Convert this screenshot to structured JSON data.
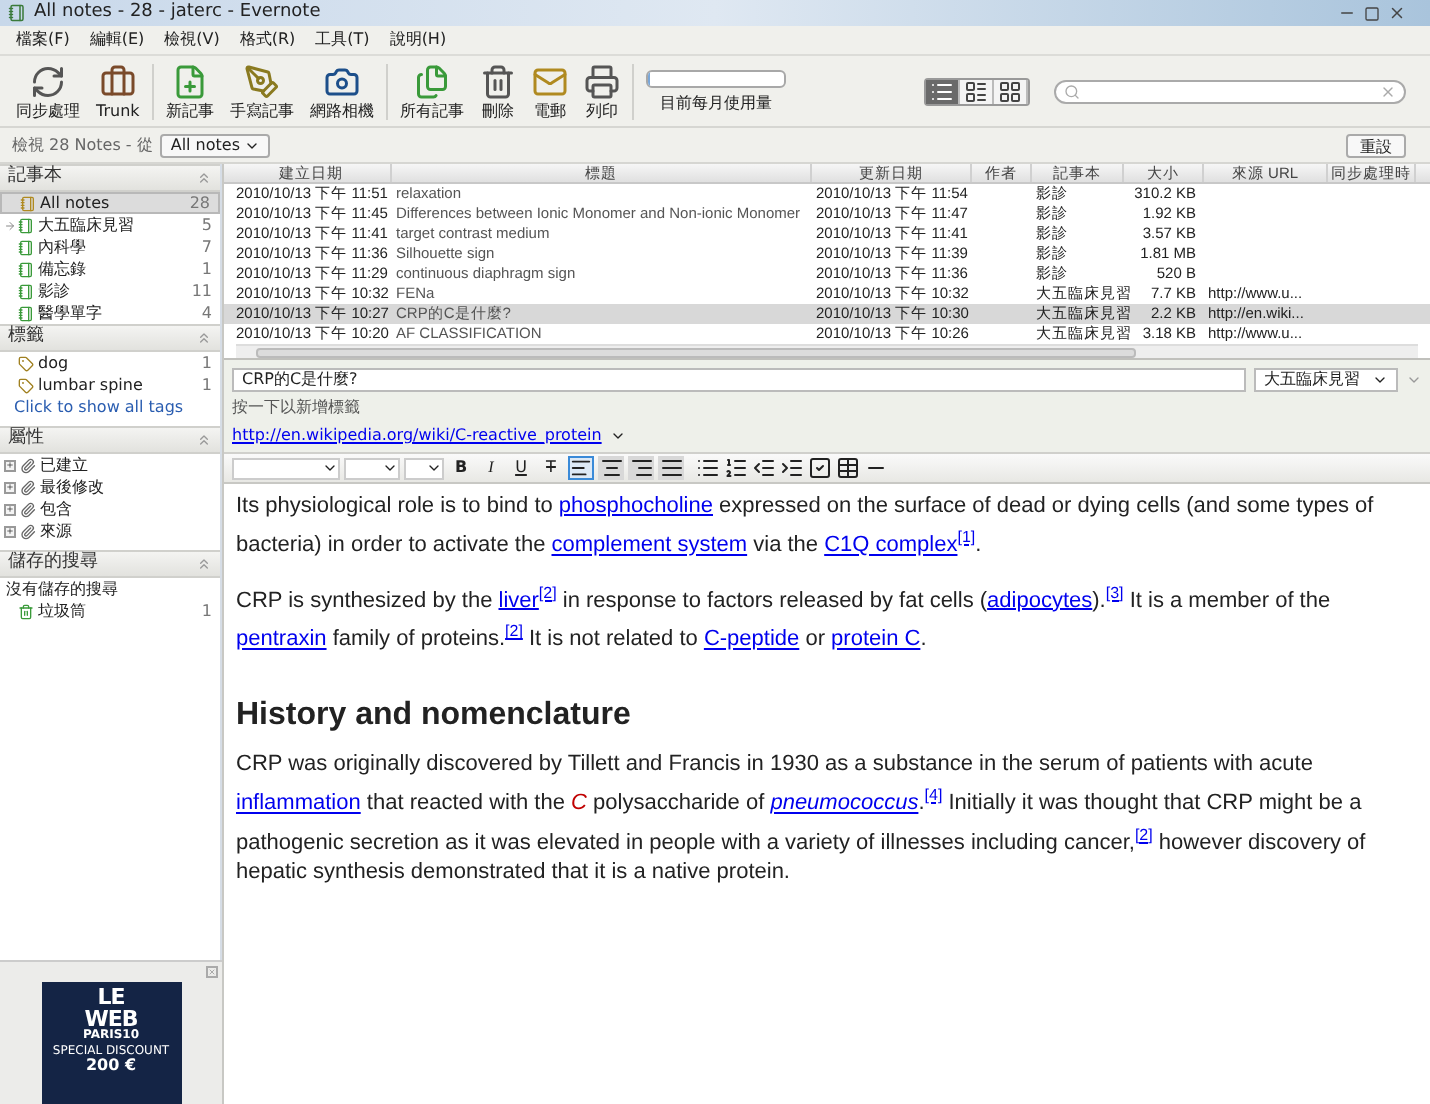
{
  "window": {
    "title": "All notes - 28 - jaterc - Evernote"
  },
  "menu": [
    "檔案(F)",
    "編輯(E)",
    "檢視(V)",
    "格式(R)",
    "工具(T)",
    "說明(H)"
  ],
  "toolbar": [
    {
      "kind": "sync",
      "label": "同步處理"
    },
    {
      "kind": "trunk",
      "label": "Trunk"
    },
    {
      "kind": "new",
      "label": "新記事"
    },
    {
      "kind": "ink",
      "label": "手寫記事"
    },
    {
      "kind": "webcam",
      "label": "網路相機"
    },
    {
      "kind": "all",
      "label": "所有記事"
    },
    {
      "kind": "delete",
      "label": "刪除"
    },
    {
      "kind": "email",
      "label": "電郵"
    },
    {
      "kind": "print",
      "label": "列印"
    }
  ],
  "usage": {
    "label": "目前每月使用量",
    "level": 0.02
  },
  "view_modes": [
    {
      "kind": "list",
      "selected": true
    },
    {
      "kind": "summary",
      "selected": false
    },
    {
      "kind": "thumbs",
      "selected": false
    }
  ],
  "filter": {
    "label": "檢視 28 Notes - 從",
    "dropdown": "All notes",
    "reset": "重設"
  },
  "sidebar": {
    "notebooks": {
      "title": "記事本",
      "items": [
        {
          "name": "All notes",
          "count": "28",
          "selected": true,
          "default": false
        },
        {
          "name": "大五臨床見習",
          "count": "5",
          "selected": false,
          "default": true
        },
        {
          "name": "內科學",
          "count": "7",
          "selected": false,
          "default": false
        },
        {
          "name": "備忘錄",
          "count": "1",
          "selected": false,
          "default": false
        },
        {
          "name": "影診",
          "count": "11",
          "selected": false,
          "default": false
        },
        {
          "name": "醫學單字",
          "count": "4",
          "selected": false,
          "default": false
        }
      ]
    },
    "tags": {
      "title": "標籤",
      "items": [
        {
          "name": "dog",
          "count": "1"
        },
        {
          "name": "lumbar spine",
          "count": "1"
        }
      ],
      "link": "Click to show all tags"
    },
    "attributes": {
      "title": "屬性",
      "items": [
        {
          "name": "已建立",
          "expanded": false
        },
        {
          "name": "最後修改",
          "expanded": false
        },
        {
          "name": "包含",
          "expanded": false
        },
        {
          "name": "來源",
          "expanded": false
        }
      ]
    },
    "saved_searches": {
      "title": "儲存的搜尋",
      "empty": "沒有儲存的搜尋",
      "trash": {
        "name": "垃圾筒",
        "count": "1"
      }
    },
    "ad": {
      "lines": [
        "LE",
        "WEB",
        "PARIS10",
        "SPECIAL DISCOUNT",
        "200 €"
      ]
    }
  },
  "table": {
    "columns": [
      "建立日期",
      "標題",
      "更新日期",
      "作者",
      "記事本",
      "大小",
      "來源 URL",
      "同步處理時"
    ],
    "rows": [
      {
        "cells": [
          "2010/10/13 下午 11:51",
          "relaxation",
          "2010/10/13 下午 11:54",
          "",
          "影診",
          "310.2 KB",
          ""
        ],
        "selected": false
      },
      {
        "cells": [
          "2010/10/13 下午 11:45",
          "Differences between Ionic Monomer and Non-ionic Monomer",
          "2010/10/13 下午 11:47",
          "",
          "影診",
          "1.92 KB",
          ""
        ],
        "selected": false
      },
      {
        "cells": [
          "2010/10/13 下午 11:41",
          "target contrast medium",
          "2010/10/13 下午 11:41",
          "",
          "影診",
          "3.57 KB",
          ""
        ],
        "selected": false
      },
      {
        "cells": [
          "2010/10/13 下午 11:36",
          "Silhouette sign",
          "2010/10/13 下午 11:39",
          "",
          "影診",
          "1.81 MB",
          ""
        ],
        "selected": false
      },
      {
        "cells": [
          "2010/10/13 下午 11:29",
          "continuous diaphragm sign",
          "2010/10/13 下午 11:36",
          "",
          "影診",
          "520 B",
          ""
        ],
        "selected": false
      },
      {
        "cells": [
          "2010/10/13 下午 10:32",
          "FENa",
          "2010/10/13 下午 10:32",
          "",
          "大五臨床見習",
          "7.7 KB",
          "http://www.u..."
        ],
        "selected": false
      },
      {
        "cells": [
          "2010/10/13 下午 10:27",
          "CRP的C是什麼?",
          "2010/10/13 下午 10:30",
          "",
          "大五臨床見習",
          "2.2 KB",
          "http://en.wiki..."
        ],
        "selected": true
      },
      {
        "cells": [
          "2010/10/13 下午 10:20",
          "AF CLASSIFICATION",
          "2010/10/13 下午 10:26",
          "",
          "大五臨床見習",
          "3.18 KB",
          "http://www.u..."
        ],
        "selected": false
      }
    ]
  },
  "note": {
    "title": "CRP的C是什麼?",
    "notebook": "大五臨床見習",
    "tag_hint": "按一下以新增標籤",
    "url": "http://en.wikipedia.org/wiki/C-reactive_protein",
    "format_buttons": [
      {
        "kind": "bold",
        "label": "B"
      },
      {
        "kind": "italic",
        "label": "I"
      },
      {
        "kind": "underline",
        "label": "U"
      },
      {
        "kind": "strike",
        "label": "T"
      }
    ],
    "align_buttons": [
      {
        "kind": "left",
        "selected": true
      },
      {
        "kind": "center",
        "selected": false
      },
      {
        "kind": "right",
        "selected": false
      },
      {
        "kind": "justify",
        "selected": false
      }
    ],
    "body": [
      {
        "kind": "p",
        "segments": [
          {
            "kind": "text",
            "text": "Its physiological role is to bind to "
          },
          {
            "kind": "link",
            "text": "phosphocholine"
          },
          {
            "kind": "text",
            "text": " expressed on the surface of dead or dying cells (and some types of bacteria) in order to activate the "
          },
          {
            "kind": "link",
            "text": "complement system"
          },
          {
            "kind": "text",
            "text": " via the "
          },
          {
            "kind": "link",
            "text": "C1Q complex"
          },
          {
            "kind": "ref",
            "text": "[1]"
          },
          {
            "kind": "text",
            "text": "."
          }
        ]
      },
      {
        "kind": "p",
        "segments": [
          {
            "kind": "text",
            "text": "CRP is synthesized by the "
          },
          {
            "kind": "link",
            "text": "liver"
          },
          {
            "kind": "ref",
            "text": "[2]"
          },
          {
            "kind": "text",
            "text": " in response to factors released by fat cells ("
          },
          {
            "kind": "link",
            "text": "adipocytes"
          },
          {
            "kind": "text",
            "text": ")."
          },
          {
            "kind": "ref",
            "text": "[3]"
          },
          {
            "kind": "text",
            "text": " It is a member of the "
          },
          {
            "kind": "link",
            "text": "pentraxin"
          },
          {
            "kind": "text",
            "text": " family of proteins."
          },
          {
            "kind": "ref",
            "text": "[2]"
          },
          {
            "kind": "text",
            "text": " It is not related to "
          },
          {
            "kind": "link",
            "text": "C-peptide"
          },
          {
            "kind": "text",
            "text": " or "
          },
          {
            "kind": "link",
            "text": "protein C"
          },
          {
            "kind": "text",
            "text": "."
          }
        ]
      },
      {
        "kind": "h",
        "text": "History and nomenclature"
      },
      {
        "kind": "p",
        "segments": [
          {
            "kind": "text",
            "text": "CRP was originally discovered by Tillett and Francis in 1930 as a substance in the serum of patients with acute "
          },
          {
            "kind": "link",
            "text": "inflammation"
          },
          {
            "kind": "text",
            "text": " that reacted with the "
          },
          {
            "kind": "em",
            "text": "C"
          },
          {
            "kind": "text",
            "text": " polysaccharide of "
          },
          {
            "kind": "link_em",
            "text": "pneumococcus"
          },
          {
            "kind": "text",
            "text": "."
          },
          {
            "kind": "ref",
            "text": "[4]"
          },
          {
            "kind": "text",
            "text": " Initially it was thought that CRP might be a pathogenic secretion as it was elevated in people with a variety of illnesses including cancer,"
          },
          {
            "kind": "ref",
            "text": "[2]"
          },
          {
            "kind": "text",
            "text": " however discovery of hepatic synthesis demonstrated that it is a native protein."
          }
        ]
      }
    ]
  }
}
